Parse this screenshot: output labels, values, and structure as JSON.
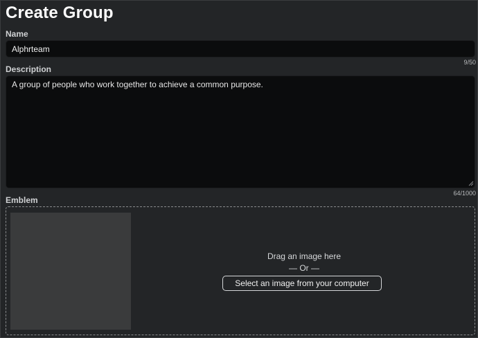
{
  "page": {
    "title": "Create Group"
  },
  "name_field": {
    "label": "Name",
    "value": "Alphrteam",
    "counter": "9/50"
  },
  "description_field": {
    "label": "Description",
    "value": "A group of people who work together to achieve a common purpose.",
    "counter": "64/1000"
  },
  "emblem": {
    "label": "Emblem",
    "drag_text": "Drag an image here",
    "or_text": "— Or —",
    "select_button_label": "Select an image from your computer"
  }
}
